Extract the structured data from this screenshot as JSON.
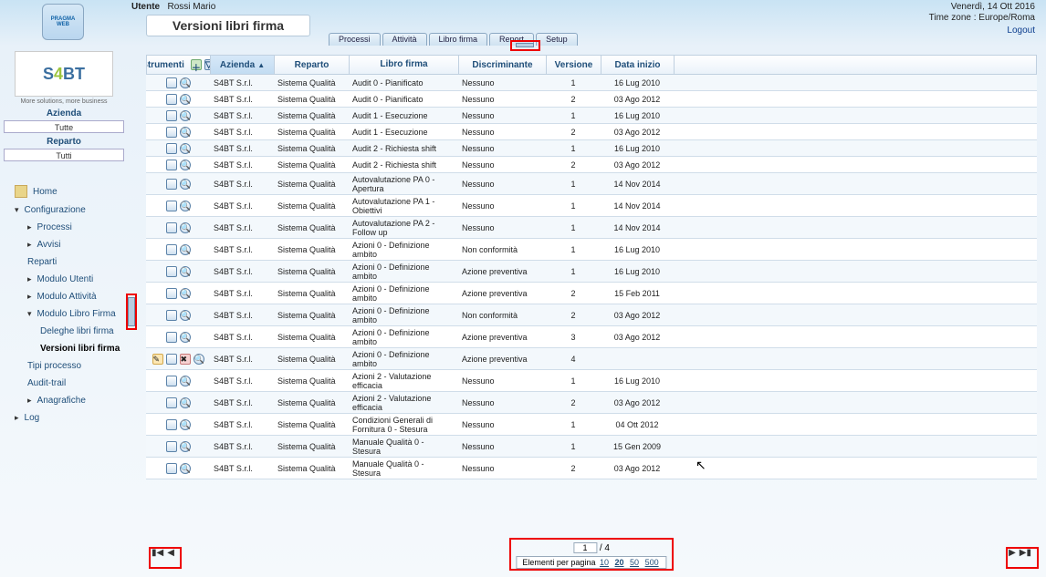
{
  "header": {
    "utente_label": "Utente",
    "utente_name": "Rossi Mario",
    "date": "Venerdì, 14 Ott 2016",
    "timezone": "Time zone : Europe/Roma",
    "logout": "Logout",
    "page_title": "Versioni libri firma",
    "logo_line1": "PRAGMA",
    "logo_line2": "WEB"
  },
  "tabs": {
    "processi": "Processi",
    "attivita": "Attività",
    "librifirma": "Libro firma",
    "report": "Report",
    "setup": "Setup"
  },
  "sidebar": {
    "logo_text": "S4BT",
    "slogan": "More solutions, more business",
    "azienda_label": "Azienda",
    "azienda_value": "Tutte",
    "reparto_label": "Reparto",
    "reparto_value": "Tutti",
    "nav": {
      "home": "Home",
      "config": "Configurazione",
      "processi": "Processi",
      "avvisi": "Avvisi",
      "reparti": "Reparti",
      "modulo_utenti": "Modulo Utenti",
      "modulo_attivita": "Modulo Attività",
      "modulo_libro": "Modulo Libro Firma",
      "deleghe": "Deleghe libri firma",
      "versioni": "Versioni libri firma",
      "tipi_processo": "Tipi processo",
      "audit": "Audit-trail",
      "anagrafiche": "Anagrafiche",
      "log": "Log"
    }
  },
  "grid": {
    "headers": {
      "strumenti": "Strumenti",
      "azienda": "Azienda",
      "reparto": "Reparto",
      "libro": "Libro firma",
      "discr": "Discriminante",
      "versione": "Versione",
      "data": "Data inizio"
    },
    "rows": [
      {
        "az": "S4BT S.r.l.",
        "rep": "Sistema Qualità",
        "lib": "Audit 0 - Pianificato",
        "disc": "Nessuno",
        "ver": "1",
        "data": "16 Lug 2010"
      },
      {
        "az": "S4BT S.r.l.",
        "rep": "Sistema Qualità",
        "lib": "Audit 0 - Pianificato",
        "disc": "Nessuno",
        "ver": "2",
        "data": "03 Ago 2012"
      },
      {
        "az": "S4BT S.r.l.",
        "rep": "Sistema Qualità",
        "lib": "Audit 1 - Esecuzione",
        "disc": "Nessuno",
        "ver": "1",
        "data": "16 Lug 2010"
      },
      {
        "az": "S4BT S.r.l.",
        "rep": "Sistema Qualità",
        "lib": "Audit 1 - Esecuzione",
        "disc": "Nessuno",
        "ver": "2",
        "data": "03 Ago 2012"
      },
      {
        "az": "S4BT S.r.l.",
        "rep": "Sistema Qualità",
        "lib": "Audit 2 - Richiesta shift",
        "disc": "Nessuno",
        "ver": "1",
        "data": "16 Lug 2010"
      },
      {
        "az": "S4BT S.r.l.",
        "rep": "Sistema Qualità",
        "lib": "Audit 2 - Richiesta shift",
        "disc": "Nessuno",
        "ver": "2",
        "data": "03 Ago 2012"
      },
      {
        "az": "S4BT S.r.l.",
        "rep": "Sistema Qualità",
        "lib": "Autovalutazione PA 0 - Apertura",
        "disc": "Nessuno",
        "ver": "1",
        "data": "14 Nov 2014",
        "multi": true
      },
      {
        "az": "S4BT S.r.l.",
        "rep": "Sistema Qualità",
        "lib": "Autovalutazione PA 1 - Obiettivi",
        "disc": "Nessuno",
        "ver": "1",
        "data": "14 Nov 2014",
        "multi": true
      },
      {
        "az": "S4BT S.r.l.",
        "rep": "Sistema Qualità",
        "lib": "Autovalutazione PA 2 - Follow up",
        "disc": "Nessuno",
        "ver": "1",
        "data": "14 Nov 2014",
        "multi": true
      },
      {
        "az": "S4BT S.r.l.",
        "rep": "Sistema Qualità",
        "lib": "Azioni 0 - Definizione ambito",
        "disc": "Non conformità",
        "ver": "1",
        "data": "16 Lug 2010",
        "multi": true
      },
      {
        "az": "S4BT S.r.l.",
        "rep": "Sistema Qualità",
        "lib": "Azioni 0 - Definizione ambito",
        "disc": "Azione preventiva",
        "ver": "1",
        "data": "16 Lug 2010",
        "multi": true
      },
      {
        "az": "S4BT S.r.l.",
        "rep": "Sistema Qualità",
        "lib": "Azioni 0 - Definizione ambito",
        "disc": "Azione preventiva",
        "ver": "2",
        "data": "15 Feb 2011",
        "multi": true
      },
      {
        "az": "S4BT S.r.l.",
        "rep": "Sistema Qualità",
        "lib": "Azioni 0 - Definizione ambito",
        "disc": "Non conformità",
        "ver": "2",
        "data": "03 Ago 2012",
        "multi": true
      },
      {
        "az": "S4BT S.r.l.",
        "rep": "Sistema Qualità",
        "lib": "Azioni 0 - Definizione ambito",
        "disc": "Azione preventiva",
        "ver": "3",
        "data": "03 Ago 2012",
        "multi": true
      },
      {
        "az": "S4BT S.r.l.",
        "rep": "Sistema Qualità",
        "lib": "Azioni 0 - Definizione ambito",
        "disc": "Azione preventiva",
        "ver": "4",
        "data": "",
        "multi": true,
        "edit": true
      },
      {
        "az": "S4BT S.r.l.",
        "rep": "Sistema Qualità",
        "lib": "Azioni 2 - Valutazione efficacia",
        "disc": "Nessuno",
        "ver": "1",
        "data": "16 Lug 2010",
        "multi": true
      },
      {
        "az": "S4BT S.r.l.",
        "rep": "Sistema Qualità",
        "lib": "Azioni 2 - Valutazione efficacia",
        "disc": "Nessuno",
        "ver": "2",
        "data": "03 Ago 2012",
        "multi": true
      },
      {
        "az": "S4BT S.r.l.",
        "rep": "Sistema Qualità",
        "lib": "Condizioni Generali di Fornitura 0 - Stesura",
        "disc": "Nessuno",
        "ver": "1",
        "data": "04 Ott 2012",
        "multi": true
      },
      {
        "az": "S4BT S.r.l.",
        "rep": "Sistema Qualità",
        "lib": "Manuale Qualità 0 - Stesura",
        "disc": "Nessuno",
        "ver": "1",
        "data": "15 Gen 2009",
        "multi": true
      },
      {
        "az": "S4BT S.r.l.",
        "rep": "Sistema Qualità",
        "lib": "Manuale Qualità 0 - Stesura",
        "disc": "Nessuno",
        "ver": "2",
        "data": "03 Ago 2012",
        "multi": true
      }
    ]
  },
  "pager": {
    "page": "1",
    "pages": "/ 4",
    "label": "Elementi per pagina",
    "sizes": [
      "10",
      "20",
      "50",
      "500"
    ],
    "selected": "20"
  }
}
